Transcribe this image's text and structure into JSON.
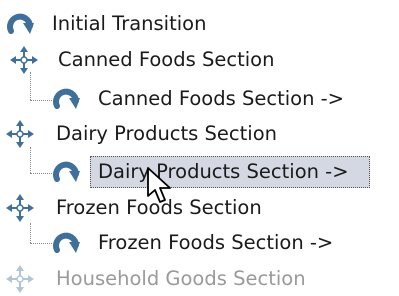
{
  "tree": {
    "items": [
      {
        "label": "Initial Transition",
        "icon": "transition-arrow-icon"
      },
      {
        "label": "Canned Foods Section",
        "icon": "move-state-icon"
      },
      {
        "label": "Canned Foods Section ->",
        "icon": "transition-arrow-icon"
      },
      {
        "label": "Dairy Products Section",
        "icon": "move-state-icon"
      },
      {
        "label": "Dairy Products Section ->",
        "icon": "transition-arrow-icon",
        "selected": true
      },
      {
        "label": "Frozen Foods Section",
        "icon": "move-state-icon"
      },
      {
        "label": "Frozen Foods Section ->",
        "icon": "transition-arrow-icon"
      },
      {
        "label": "Household Goods Section",
        "icon": "move-state-icon"
      }
    ]
  },
  "colors": {
    "icon_blue": "#3f6f9b",
    "selection_bg": "#d3d8e2",
    "text": "#1a1a1a",
    "faded_text": "#9a9a9a"
  }
}
